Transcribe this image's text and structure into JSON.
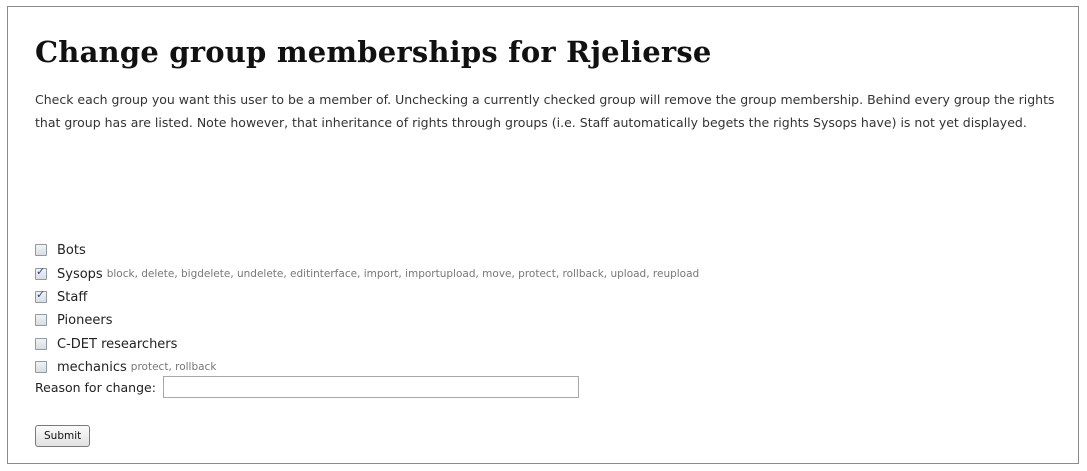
{
  "page": {
    "title": "Change group memberships for Rjelierse",
    "intro": "Check each group you want this user to be a member of. Unchecking a currently checked group will remove the group membership. Behind every group the rights that group has are listed. Note however, that inheritance of rights through groups (i.e. Staff automatically begets the rights Sysops have) is not yet displayed."
  },
  "groups": [
    {
      "name": "Bots",
      "checked": false,
      "rights": ""
    },
    {
      "name": "Sysops",
      "checked": true,
      "rights": "block, delete, bigdelete, undelete, editinterface, import, importupload, move, protect, rollback, upload, reupload"
    },
    {
      "name": "Staff",
      "checked": true,
      "rights": ""
    },
    {
      "name": "Pioneers",
      "checked": false,
      "rights": ""
    },
    {
      "name": "C-DET researchers",
      "checked": false,
      "rights": ""
    },
    {
      "name": "mechanics",
      "checked": false,
      "rights": "protect, rollback"
    }
  ],
  "form": {
    "reason_label": "Reason for change:",
    "reason_value": "",
    "submit_label": "Submit"
  }
}
